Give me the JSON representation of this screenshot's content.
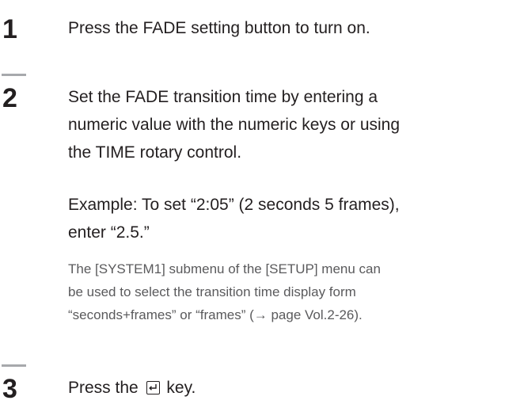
{
  "steps": [
    {
      "number": "1",
      "lines": [
        "Press the FADE setting button to turn on."
      ]
    },
    {
      "number": "2",
      "lines": [
        "Set the FADE transition time by entering a",
        "numeric value with the numeric keys or using",
        "the TIME rotary control."
      ],
      "example_lines": [
        "Example: To set “2:05” (2 seconds 5 frames),",
        "enter “2.5.”"
      ],
      "note_lines": [
        "The [SYSTEM1] submenu of the [SETUP] menu can",
        "be used to select the transition time display form",
        "“seconds+frames” or “frames” (→ page Vol.2-26)."
      ]
    },
    {
      "number": "3",
      "text_before_key": "Press the",
      "key_icon": "enter-key-icon",
      "text_after_key": "key."
    }
  ]
}
